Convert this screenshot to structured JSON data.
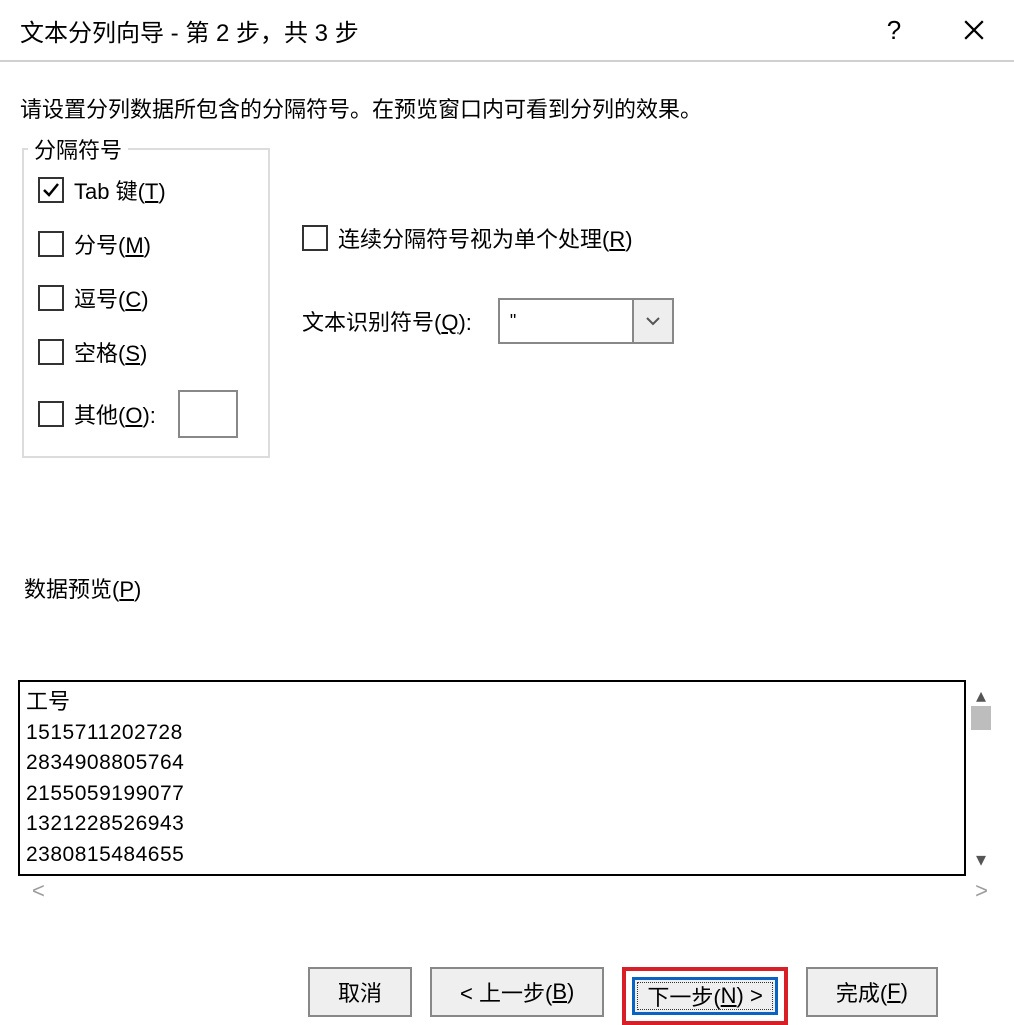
{
  "title": "文本分列向导 - 第 2 步，共 3 步",
  "instruction": "请设置分列数据所包含的分隔符号。在预览窗口内可看到分列的效果。",
  "delimiters": {
    "legend": "分隔符号",
    "tab": {
      "label_prefix": "Tab 键(",
      "accel": "T",
      "label_suffix": ")",
      "checked": true
    },
    "semi": {
      "label_prefix": "分号(",
      "accel": "M",
      "label_suffix": ")",
      "checked": false
    },
    "comma": {
      "label_prefix": "逗号(",
      "accel": "C",
      "label_suffix": ")",
      "checked": false
    },
    "space": {
      "label_prefix": "空格(",
      "accel": "S",
      "label_suffix": ")",
      "checked": false
    },
    "other": {
      "label_prefix": "其他(",
      "accel": "O",
      "label_suffix": "):",
      "checked": false,
      "value": ""
    }
  },
  "consecutive": {
    "label_prefix": "连续分隔符号视为单个处理(",
    "accel": "R",
    "label_suffix": ")",
    "checked": false
  },
  "text_qualifier": {
    "label_prefix": "文本识别符号(",
    "accel": "Q",
    "label_suffix": "):",
    "value": "\""
  },
  "preview": {
    "label_prefix": "数据预览(",
    "accel": "P",
    "label_suffix": ")",
    "header": "工号",
    "rows": [
      "1515711202728",
      "2834908805764",
      "2155059199077",
      "1321228526943",
      "2380815484655"
    ]
  },
  "buttons": {
    "cancel": "取消",
    "back_prefix": "< 上一步(",
    "back_accel": "B",
    "back_suffix": ")",
    "next_prefix": "下一步(",
    "next_accel": "N",
    "next_suffix": ") >",
    "finish_prefix": "完成(",
    "finish_accel": "F",
    "finish_suffix": ")"
  }
}
